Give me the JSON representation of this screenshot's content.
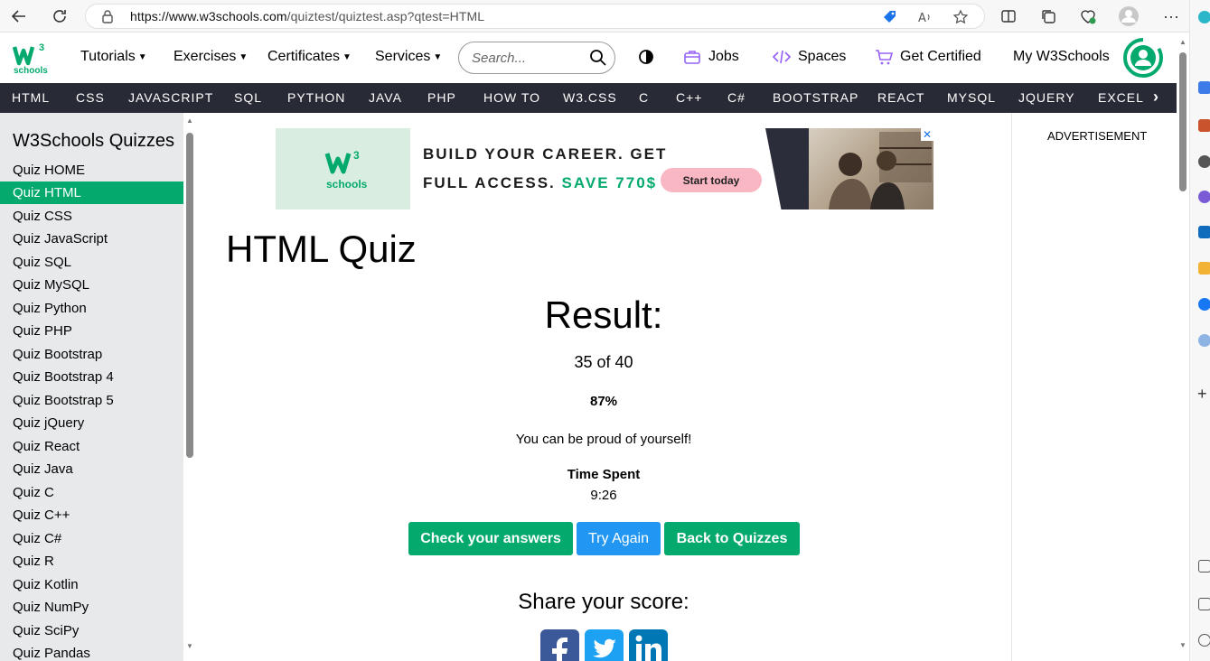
{
  "browser": {
    "url_host": "https://www.w3schools.com",
    "url_path": "/quiztest/quiztest.asp?qtest=HTML"
  },
  "header": {
    "logo_text": "schools",
    "logo_sup": "3",
    "menus": [
      "Tutorials",
      "Exercises",
      "Certificates",
      "Services"
    ],
    "search_placeholder": "Search...",
    "jobs": "Jobs",
    "spaces": "Spaces",
    "get_certified": "Get Certified",
    "my_w3schools": "My W3Schools"
  },
  "topics": [
    "HTML",
    "CSS",
    "JAVASCRIPT",
    "SQL",
    "PYTHON",
    "JAVA",
    "PHP",
    "HOW TO",
    "W3.CSS",
    "C",
    "C++",
    "C#",
    "BOOTSTRAP",
    "REACT",
    "MYSQL",
    "JQUERY",
    "EXCEL"
  ],
  "sidebar": {
    "title": "W3Schools Quizzes",
    "items": [
      "Quiz HOME",
      "Quiz HTML",
      "Quiz CSS",
      "Quiz JavaScript",
      "Quiz SQL",
      "Quiz MySQL",
      "Quiz Python",
      "Quiz PHP",
      "Quiz Bootstrap",
      "Quiz Bootstrap 4",
      "Quiz Bootstrap 5",
      "Quiz jQuery",
      "Quiz React",
      "Quiz Java",
      "Quiz C",
      "Quiz C++",
      "Quiz C#",
      "Quiz R",
      "Quiz Kotlin",
      "Quiz NumPy",
      "Quiz SciPy",
      "Quiz Pandas"
    ],
    "active": "Quiz HTML"
  },
  "ad": {
    "line1": "BUILD YOUR CAREER. GET",
    "line2": "FULL ACCESS.",
    "line2_highlight": "SAVE 770$",
    "cta": "Start today",
    "logo_text": "schools",
    "close": "✕"
  },
  "main": {
    "title": "HTML Quiz",
    "result_title": "Result:",
    "score": "35 of 40",
    "percent": "87%",
    "message": "You can be proud of yourself!",
    "time_label": "Time Spent",
    "time_value": "9:26",
    "buttons": {
      "check": "Check your answers",
      "retry": "Try Again",
      "back": "Back to Quizzes"
    },
    "share_title": "Share your score:"
  },
  "side_ad_label": "ADVERTISEMENT",
  "colors": {
    "brand_green": "#04aa6d",
    "nav_dark": "#282a35",
    "button_blue": "#2196f3",
    "sidebar_bg": "#e7e9eb"
  }
}
